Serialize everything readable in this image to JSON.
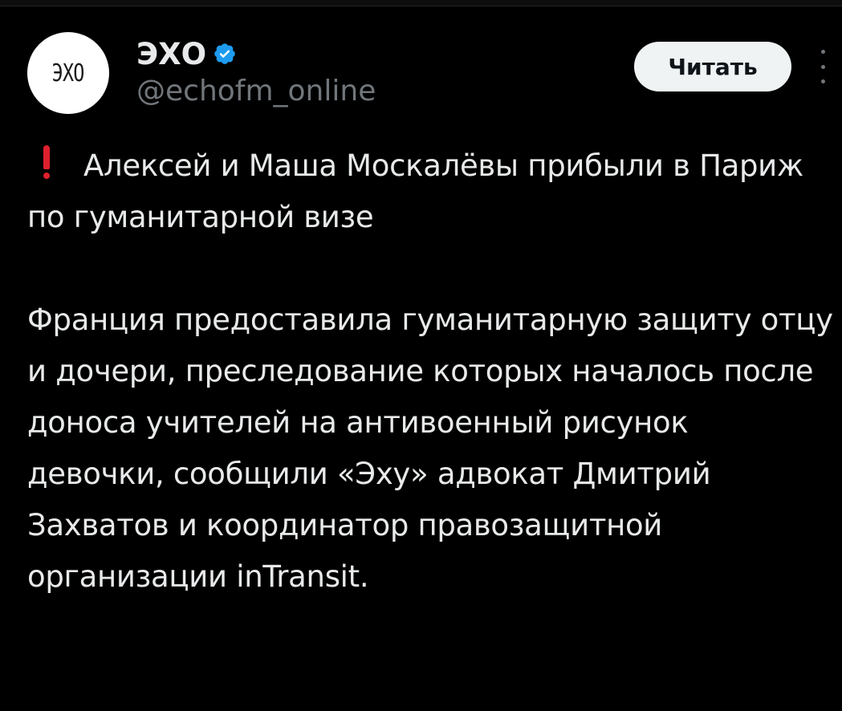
{
  "author": {
    "avatar_text": "ЭXO",
    "display_name": "ЭХО",
    "verified_icon": "verified-badge-icon",
    "handle": "@echofm_online"
  },
  "actions": {
    "follow_label": "Читать",
    "more_icon": "more-vertical-icon"
  },
  "tweet": {
    "emoji": "exclamation-icon",
    "headline": "Алексей и Маша Москалёвы прибыли в Париж по гуманитарной визе",
    "body": "Франция предоставила гуманитарную защиту отцу и дочери, преследование которых началось после доноса учителей на антивоенный рисунок девочки, сообщили «Эху» адвокат Дмитрий Захватов и координатор правозащитной организации inTransit."
  },
  "colors": {
    "background": "#000000",
    "text": "#e7e9ea",
    "secondary_text": "#71767b",
    "verified": "#1d9bf0",
    "button_bg": "#eff3f4",
    "exclamation": "#e0202e"
  }
}
